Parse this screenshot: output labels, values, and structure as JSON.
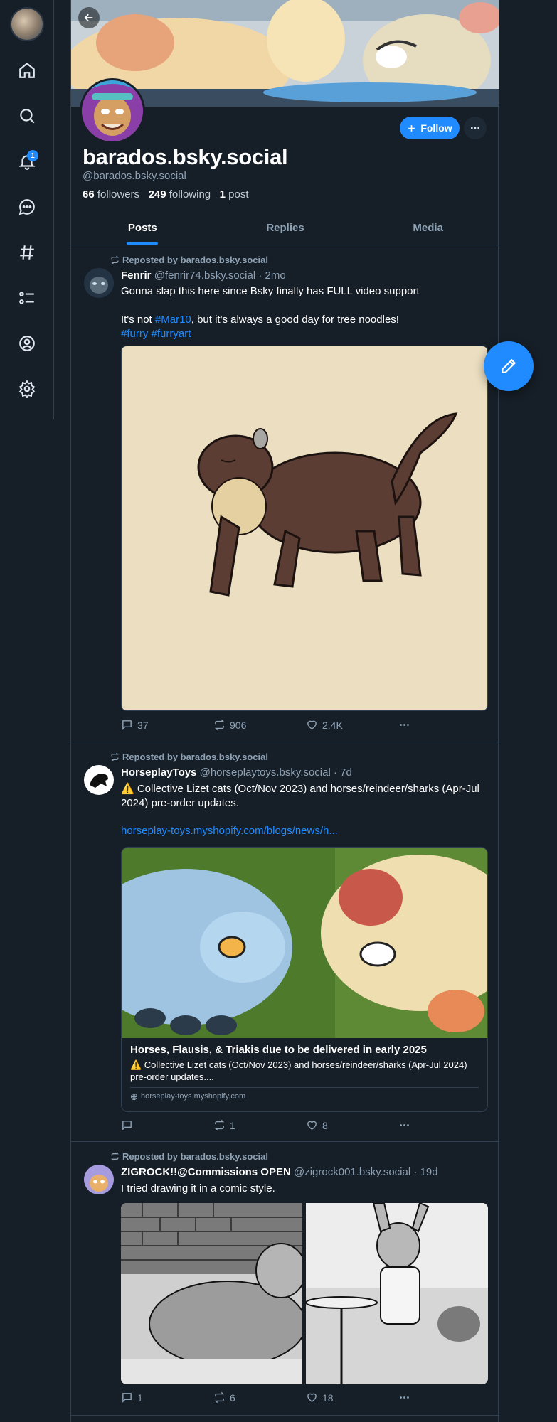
{
  "profile": {
    "display_name": "barados.bsky.social",
    "handle": "@barados.bsky.social",
    "followers_count": "66",
    "followers_label": "followers",
    "following_count": "249",
    "following_label": "following",
    "posts_count": "1",
    "posts_label": "post",
    "follow_label": "Follow"
  },
  "nav": {
    "notification_count": "1",
    "icons": [
      "home-icon",
      "search-icon",
      "bell-icon",
      "chat-icon",
      "hash-icon",
      "list-icon",
      "profile-icon",
      "gear-icon"
    ]
  },
  "tabs": [
    {
      "label": "Posts",
      "active": true
    },
    {
      "label": "Replies",
      "active": false
    },
    {
      "label": "Media",
      "active": false
    }
  ],
  "posts": [
    {
      "repost_label": "Reposted by barados.bsky.social",
      "author": "Fenrir",
      "handle": "@fenrir74.bsky.social",
      "time": "· 2mo",
      "text_line1": "Gonna slap this here since Bsky finally has FULL video support",
      "text_line2_pre": "It's not ",
      "text_line2_tag": "#Mar10",
      "text_line2_post": ", but it's always a good day for tree noodles!",
      "text_tags": "#furry #furryart",
      "replies": "37",
      "reposts": "906",
      "likes": "2.4K"
    },
    {
      "repost_label": "Reposted by barados.bsky.social",
      "author": "HorseplayToys",
      "handle": "@horseplaytoys.bsky.social",
      "time": "· 7d",
      "text": "⚠️ Collective Lizet cats (Oct/Nov 2023) and horses/reindeer/sharks (Apr-Jul 2024) pre-order updates.",
      "link": "horseplay-toys.myshopify.com/blogs/news/h...",
      "card_title": "Horses, Flausis, & Triakis due to be delivered in early 2025",
      "card_desc": "⚠️ Collective Lizet cats (Oct/Nov 2023) and horses/reindeer/sharks (Apr-Jul 2024) pre-order updates....",
      "card_domain": "horseplay-toys.myshopify.com",
      "replies": "",
      "reposts": "1",
      "likes": "8"
    },
    {
      "repost_label": "Reposted by barados.bsky.social",
      "author": "ZIGROCK!!@Commissions OPEN",
      "handle": "@zigrock001.bsky.social",
      "time": "· 19d",
      "text": "I tried drawing it in a comic style.",
      "replies": "1",
      "reposts": "6",
      "likes": "18"
    }
  ],
  "colors": {
    "background": "#161e27",
    "accent": "#208bfe",
    "muted": "#8ea2b5",
    "border": "#2e4052"
  }
}
